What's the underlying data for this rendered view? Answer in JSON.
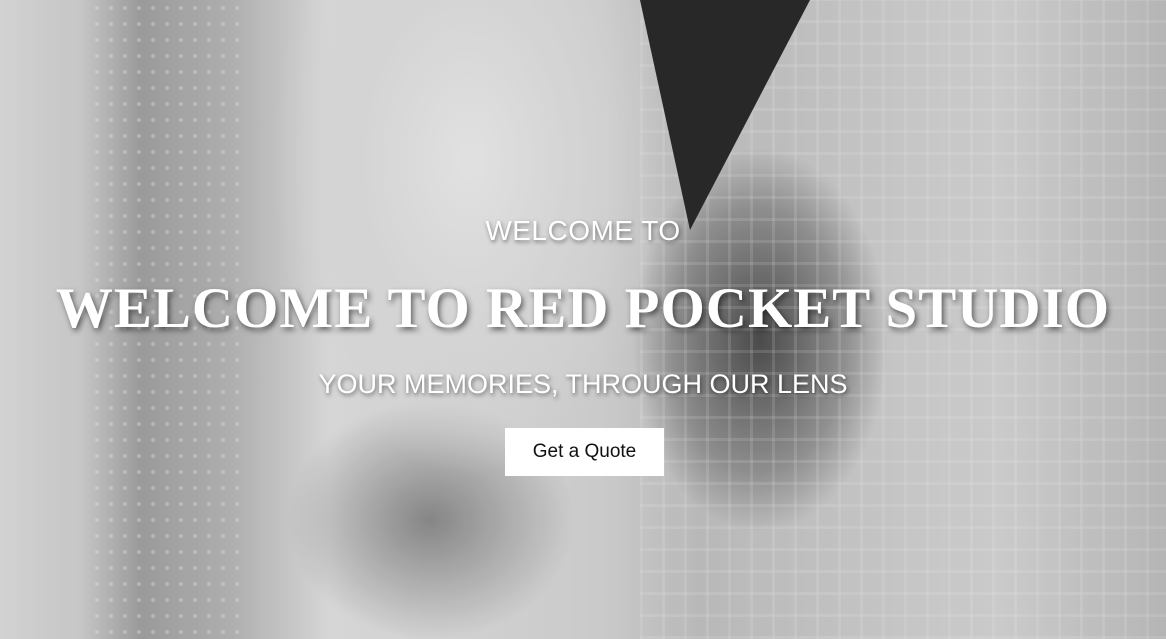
{
  "hero": {
    "eyebrow": "WELCOME TO",
    "title": "WELCOME TO RED POCKET STUDIO",
    "tagline": "YOUR MEMORIES, THROUGH OUR LENS",
    "cta_label": "Get a Quote"
  },
  "colors": {
    "text": "#ffffff",
    "button_bg": "#ffffff",
    "button_text": "#111111"
  }
}
